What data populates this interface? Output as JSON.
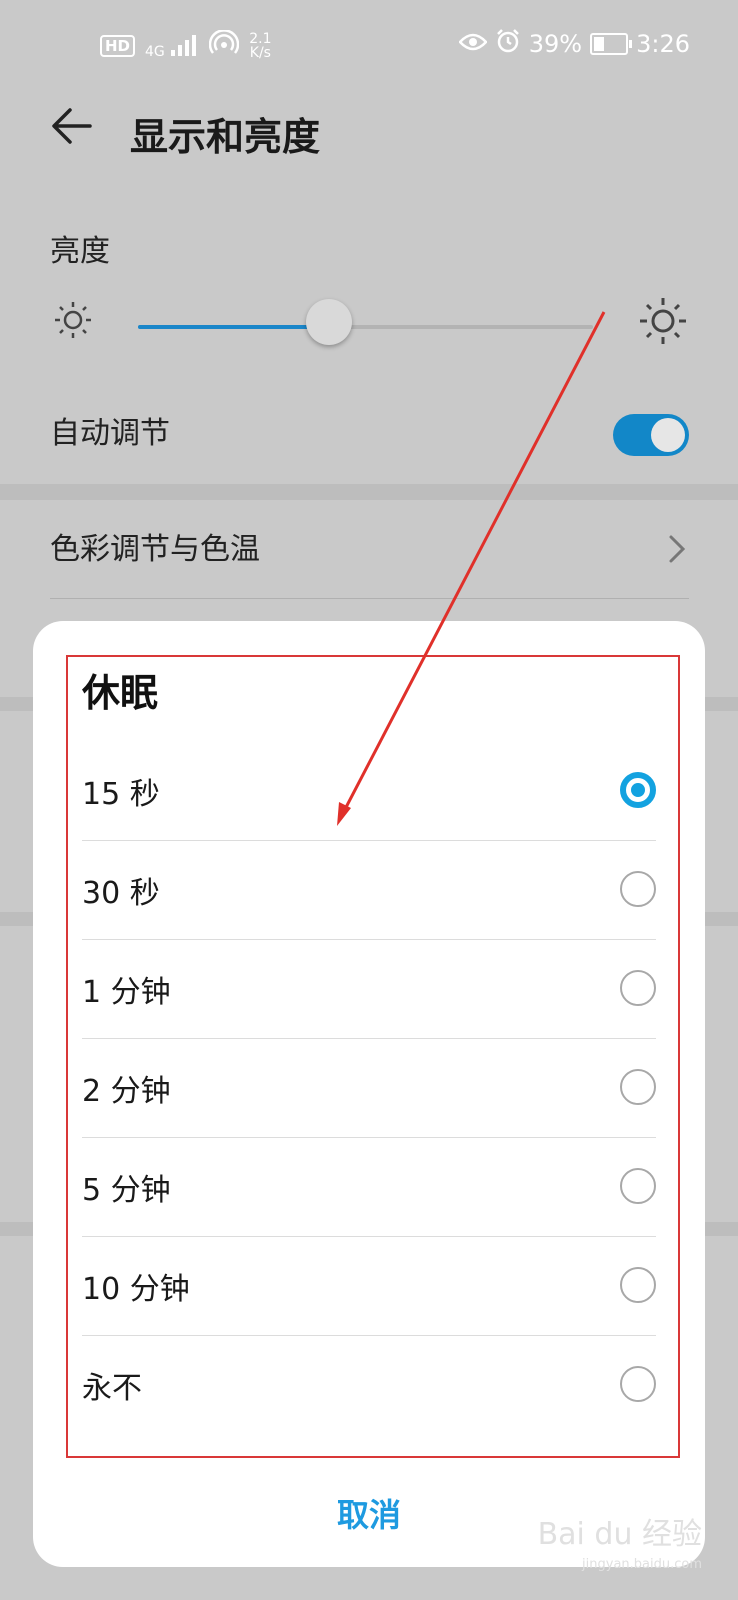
{
  "status_bar": {
    "hd": "HD",
    "network": "4G",
    "speed_value": "2.1",
    "speed_unit": "K/s",
    "battery_percent": "39%",
    "battery_level": 0.39,
    "time": "3:26",
    "icons": [
      "eye-icon",
      "alarm-icon",
      "battery-icon",
      "signal-icon",
      "hotspot-icon"
    ]
  },
  "header": {
    "title": "显示和亮度"
  },
  "brightness": {
    "label": "亮度",
    "level": 0.42
  },
  "auto_adjust": {
    "label": "自动调节",
    "enabled": true
  },
  "color_temp": {
    "label": "色彩调节与色温"
  },
  "dialog": {
    "title": "休眠",
    "options": [
      {
        "label": "15 秒",
        "selected": true
      },
      {
        "label": "30 秒",
        "selected": false
      },
      {
        "label": "1 分钟",
        "selected": false
      },
      {
        "label": "2 分钟",
        "selected": false
      },
      {
        "label": "5 分钟",
        "selected": false
      },
      {
        "label": "10 分钟",
        "selected": false
      },
      {
        "label": "永不",
        "selected": false
      }
    ],
    "cancel_label": "取消"
  },
  "watermark": {
    "brand": "Bai du 经验",
    "url": "jingyan.baidu.com"
  },
  "colors": {
    "accent": "#1287c8",
    "radio_selected": "#13a2e0",
    "annotation": "#e0302a"
  }
}
